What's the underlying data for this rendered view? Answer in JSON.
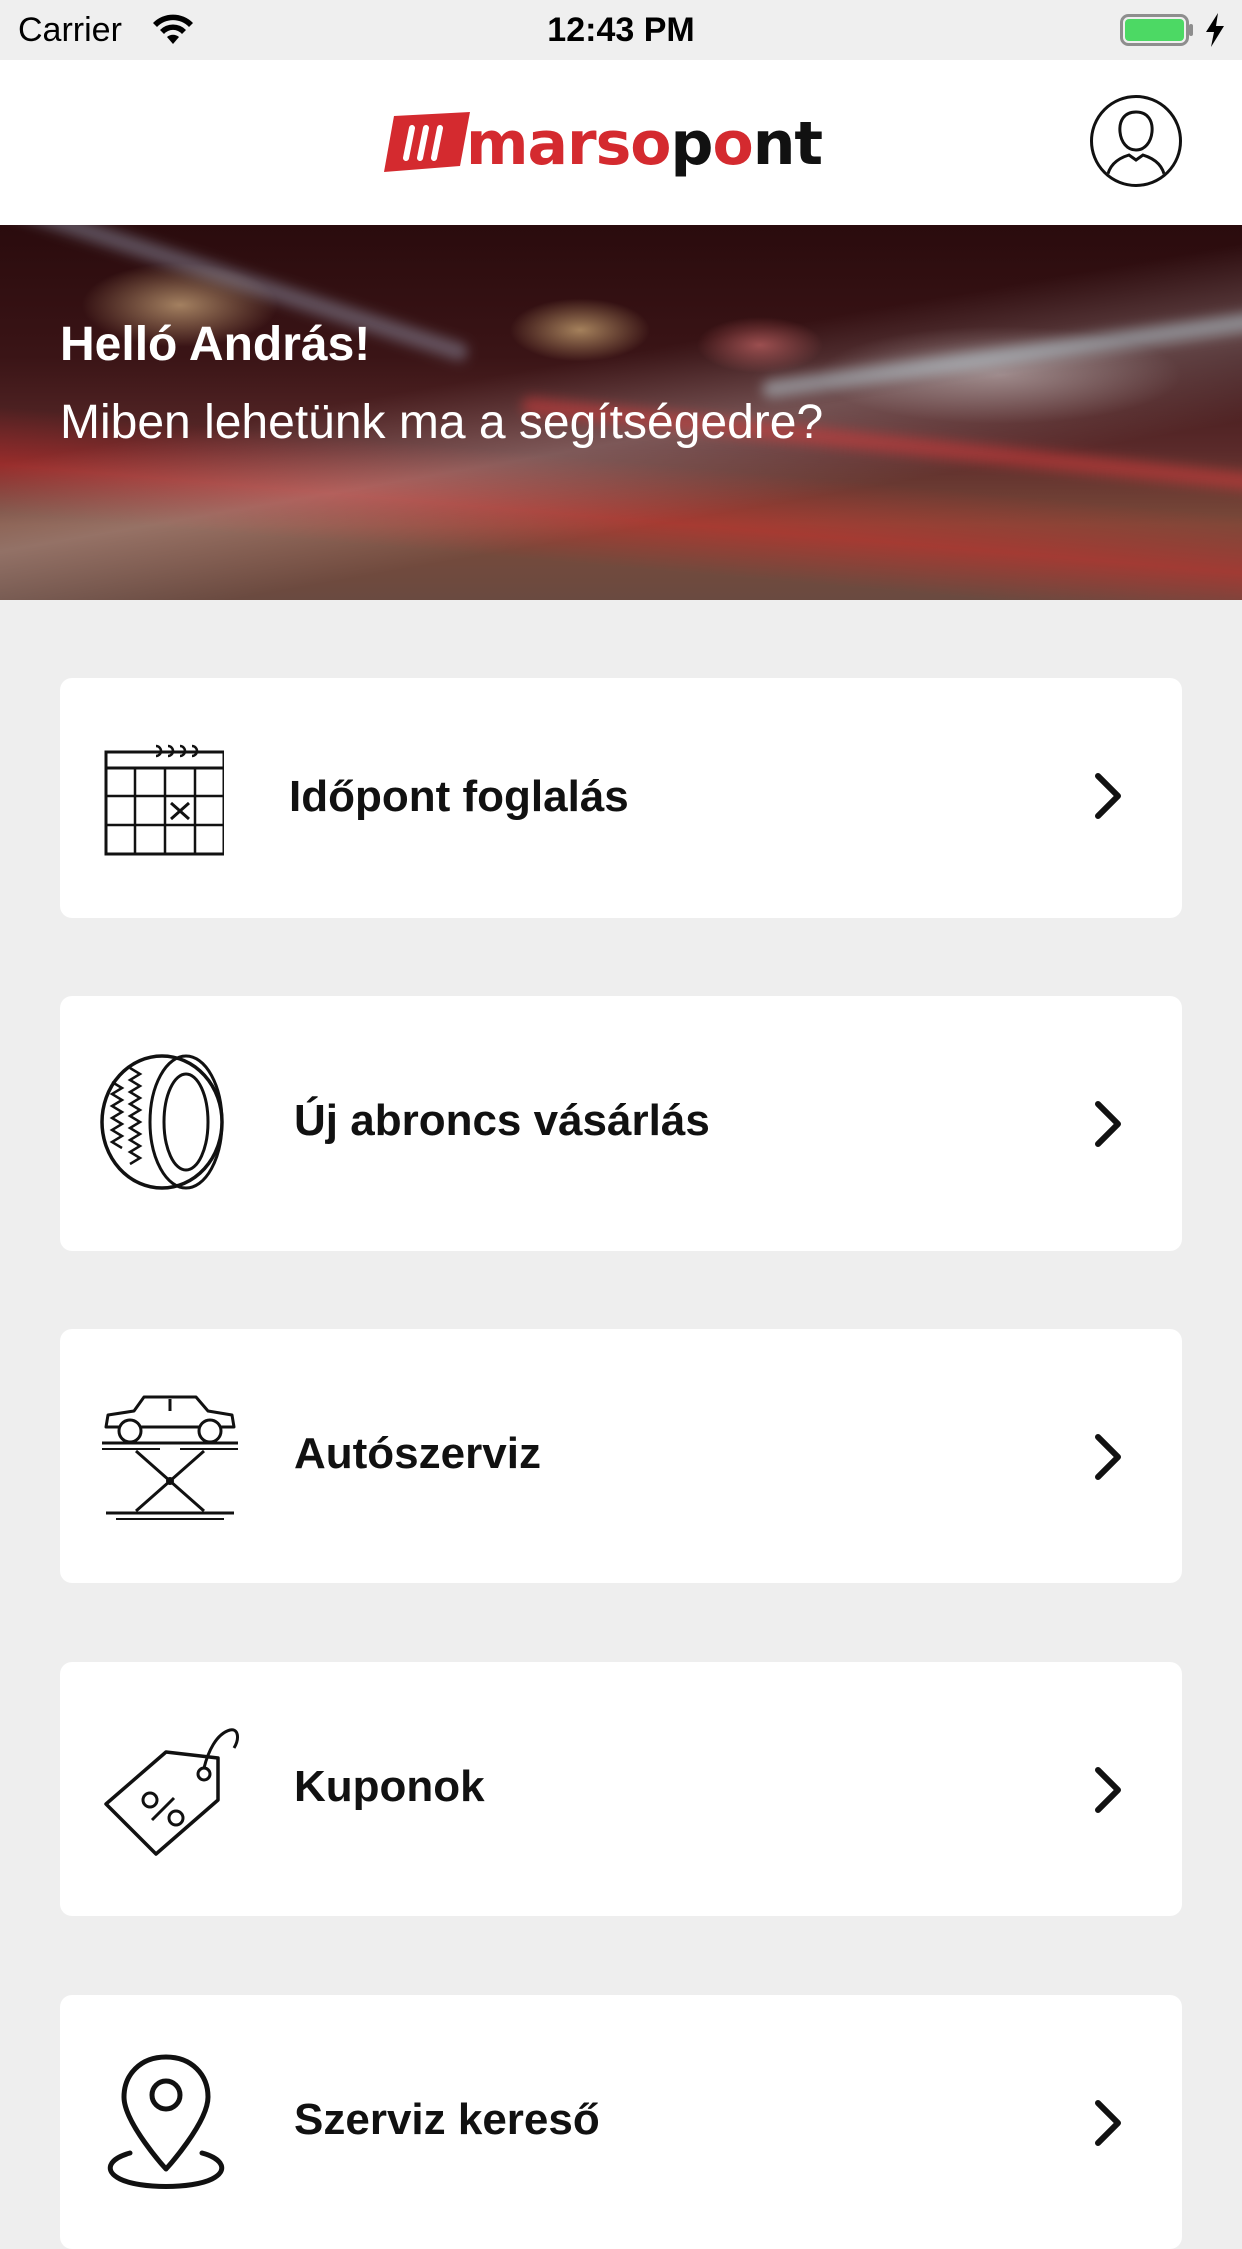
{
  "status_bar": {
    "carrier": "Carrier",
    "time": "12:43 PM",
    "battery_color": "#4cd964"
  },
  "nav": {
    "logo_text_red": "marso",
    "logo_text_p": "p",
    "logo_text_o": "o",
    "logo_text_nt": "nt",
    "brand_color": "#d42a2f",
    "profile_icon": "user-icon"
  },
  "hero": {
    "greeting": "Helló András!",
    "subtitle": "Miben lehetünk ma a segítségedre?"
  },
  "menu": {
    "items": [
      {
        "label": "Időpont foglalás",
        "icon": "calendar-icon"
      },
      {
        "label": "Új abroncs vásárlás",
        "icon": "tire-icon"
      },
      {
        "label": "Autószerviz",
        "icon": "car-lift-icon"
      },
      {
        "label": "Kuponok",
        "icon": "coupon-tag-icon"
      },
      {
        "label": "Szerviz kereső",
        "icon": "location-pin-icon"
      }
    ],
    "chevron_icon": "chevron-right-icon"
  }
}
